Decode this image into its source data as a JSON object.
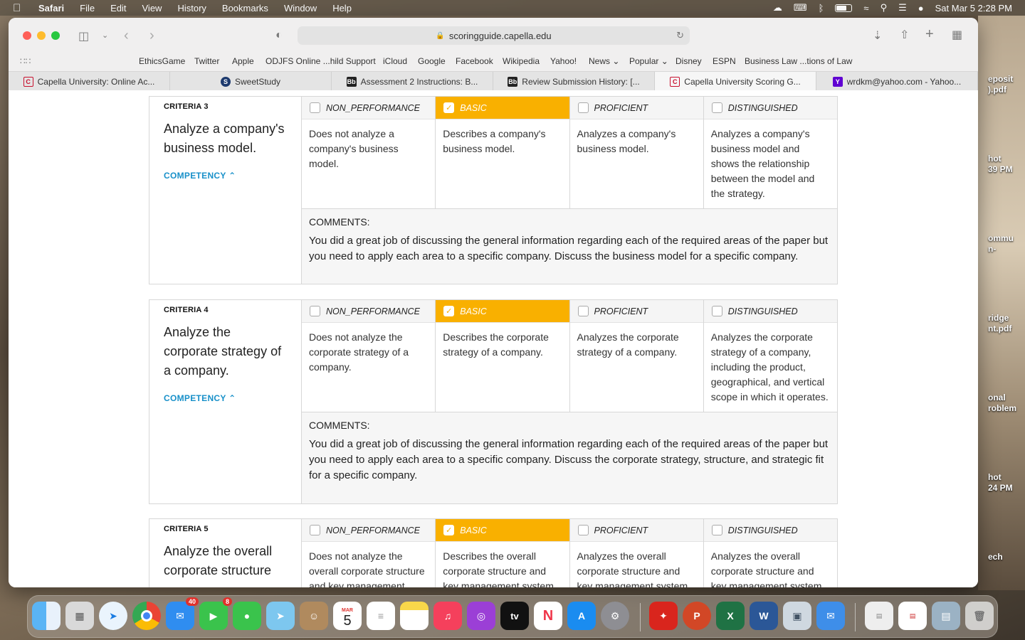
{
  "menubar": {
    "app": "Safari",
    "items": [
      "File",
      "Edit",
      "View",
      "History",
      "Bookmarks",
      "Window",
      "Help"
    ],
    "datetime": "Sat Mar 5  2:28 PM"
  },
  "browser": {
    "url": "scoringguide.capella.edu",
    "favorites": [
      "EthicsGame",
      "Twitter",
      "Apple",
      "ODJFS Online ...hild Support",
      "iCloud",
      "Google",
      "Facebook",
      "Wikipedia",
      "Yahoo!",
      "News",
      "Popular",
      "Disney",
      "ESPN",
      "Business Law ...tions of Law"
    ],
    "tabs": [
      {
        "label": "Capella University: Online Ac...",
        "icon": "C"
      },
      {
        "label": "SweetStudy",
        "icon": "S"
      },
      {
        "label": "Assessment 2 Instructions: B...",
        "icon": "Bb"
      },
      {
        "label": "Review Submission History: [...",
        "icon": "Bb"
      },
      {
        "label": "Capella University Scoring G...",
        "icon": "C"
      },
      {
        "label": "wrdkm@yahoo.com - Yahoo...",
        "icon": "Y"
      }
    ]
  },
  "levels": [
    "NON_PERFORMANCE",
    "BASIC",
    "PROFICIENT",
    "DISTINGUISHED"
  ],
  "criteria": [
    {
      "num": "CRITERIA 3",
      "title": "Analyze a company's business model.",
      "competency": "COMPETENCY",
      "selected": 1,
      "descriptions": [
        "Does not analyze a company's business model.",
        "Describes a company's business model.",
        "Analyzes a company's business model.",
        "Analyzes a company's business model and shows the relationship between the model and the strategy."
      ],
      "comments_label": "COMMENTS:",
      "comment": "You did a great job of discussing the general information regarding each of the required areas of the paper but you need to apply each area to a specific company. Discuss the business model for a specific company."
    },
    {
      "num": "CRITERIA 4",
      "title": "Analyze the corporate strategy of a company.",
      "competency": "COMPETENCY",
      "selected": 1,
      "descriptions": [
        "Does not analyze the corporate strategy of a company.",
        "Describes the corporate strategy of a company.",
        "Analyzes the corporate strategy of a company.",
        "Analyzes the corporate strategy of a company, including the product, geographical, and vertical scope in which it operates."
      ],
      "comments_label": "COMMENTS:",
      "comment": "You did a great job of discussing the general information regarding each of the required areas of the paper but you need to apply each area to a specific company. Discuss the corporate strategy, structure, and strategic fit for a specific company."
    },
    {
      "num": "CRITERIA 5",
      "title": "Analyze the overall corporate structure",
      "competency": "",
      "selected": 1,
      "descriptions": [
        "Does not analyze the overall corporate structure and key management",
        "Describes the overall corporate structure and key management system",
        "Analyzes the overall corporate structure and key management system",
        "Analyzes the overall corporate structure and key management system"
      ],
      "comments_label": "",
      "comment": ""
    }
  ],
  "desktop_labels": [
    "eposit\n).pdf",
    "hot\n39 PM",
    "ommu\nn-",
    "ridge\nnt.pdf",
    "onal\nroblem",
    "hot\n24 PM",
    "ech"
  ],
  "dock": {
    "calendar_month": "MAR",
    "calendar_day": "5",
    "mail_badge": "40",
    "facetime_badge": "8"
  }
}
